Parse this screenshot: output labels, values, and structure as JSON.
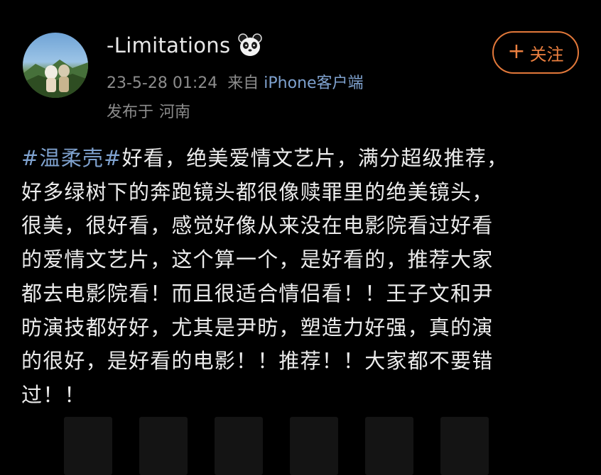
{
  "post": {
    "username": "-Limitations",
    "badge_icon": "panda-icon",
    "date": "23-5-28 01:24",
    "source_prefix": "来自",
    "source": "iPhone客户端",
    "location_prefix": "发布于",
    "location": "河南",
    "follow": {
      "icon": "+",
      "label": "关注"
    },
    "content": {
      "hashtag": "#温柔壳#",
      "lines": [
        "好看，绝美爱情文艺片，满分超级推荐，",
        "好多绿树下的奔跑镜头都很像赎罪里的绝美镜头，",
        "很美，很好看，感觉好像从来没在电影院看过好看",
        "的爱情文艺片，这个算一个，是好看的，推荐大家",
        "都去电影院看！而且很适合情侣看！！王子文和尹",
        "昉演技都好好，尤其是尹昉，塑造力好强，真的演",
        "的很好，是好看的电影！！推荐！！大家都不要错",
        "过！！"
      ]
    }
  },
  "colors": {
    "background": "#000000",
    "link": "#7fa2cf",
    "follow_accent": "#e2783a",
    "secondary_text": "#8c8c8c"
  }
}
